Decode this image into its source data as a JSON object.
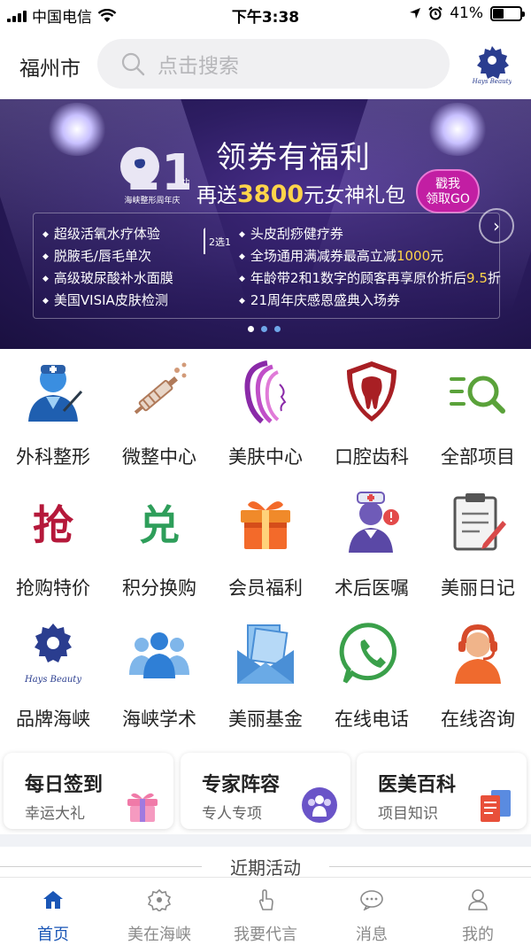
{
  "status_bar": {
    "carrier": "中国电信",
    "time": "下午3:38",
    "battery_percent": "41%",
    "battery_level": 0.41
  },
  "header": {
    "city": "福州市",
    "search_placeholder": "点击搜索",
    "logo_icon": "hays-beauty-logo"
  },
  "banner": {
    "anniversary_number": "21",
    "anniversary_sup": "th",
    "anniversary_caption": "海峡整形周年庆",
    "title": "领券有福利",
    "subtitle_prefix": "再送",
    "subtitle_amount": "3800",
    "subtitle_suffix": "元女神礼包",
    "go_button": "戳我\n领取GO",
    "choose_label": "2选1",
    "left_items": [
      "超级活氧水疗体验",
      "脱腋毛/唇毛单次",
      "高级玻尿酸补水面膜",
      "美国VISIA皮肤检测"
    ],
    "right_items": [
      {
        "pre": "头皮刮痧健疗券",
        "hl": "",
        "post": ""
      },
      {
        "pre": "全场通用满减券最高立减",
        "hl": "1000",
        "post": "元"
      },
      {
        "pre": "年龄带2和1数字的顾客再享原价折后",
        "hl": "9.5",
        "post": "折"
      },
      {
        "pre": "21周年庆感恩盛典入场券",
        "hl": "",
        "post": ""
      }
    ],
    "slide_count": 3,
    "active_slide": 1
  },
  "grid": [
    {
      "label": "外科整形",
      "icon": "surgeon-icon"
    },
    {
      "label": "微整中心",
      "icon": "syringe-icon"
    },
    {
      "label": "美肤中心",
      "icon": "woman-profile-icon"
    },
    {
      "label": "口腔齿科",
      "icon": "tooth-shield-icon"
    },
    {
      "label": "全部项目",
      "icon": "list-search-icon"
    },
    {
      "label": "抢购特价",
      "icon": "flash-sale-icon",
      "glyph": "抢"
    },
    {
      "label": "积分换购",
      "icon": "points-exchange-icon",
      "glyph": "兑"
    },
    {
      "label": "会员福利",
      "icon": "gift-box-icon"
    },
    {
      "label": "术后医嘱",
      "icon": "nurse-icon"
    },
    {
      "label": "美丽日记",
      "icon": "diary-icon"
    },
    {
      "label": "品牌海峡",
      "icon": "brand-logo-icon"
    },
    {
      "label": "海峡学术",
      "icon": "group-icon"
    },
    {
      "label": "美丽基金",
      "icon": "fund-envelope-icon"
    },
    {
      "label": "在线电话",
      "icon": "phone-icon"
    },
    {
      "label": "在线咨询",
      "icon": "consultant-icon"
    }
  ],
  "cards": [
    {
      "title": "每日签到",
      "subtitle": "幸运大礼",
      "icon": "gift-icon"
    },
    {
      "title": "专家阵容",
      "subtitle": "专人专项",
      "icon": "experts-icon"
    },
    {
      "title": "医美百科",
      "subtitle": "项目知识",
      "icon": "documents-icon"
    }
  ],
  "section_title": "近期活动",
  "tabbar": [
    {
      "label": "首页",
      "icon": "home-icon",
      "active": true
    },
    {
      "label": "美在海峡",
      "icon": "brand-icon",
      "active": false
    },
    {
      "label": "我要代言",
      "icon": "hand-icon",
      "active": false
    },
    {
      "label": "消息",
      "icon": "message-icon",
      "active": false
    },
    {
      "label": "我的",
      "icon": "user-icon",
      "active": false
    }
  ],
  "colors": {
    "accent": "#1a56b6",
    "banner_bg": "#2d1d62",
    "highlight": "#ffd44a"
  }
}
